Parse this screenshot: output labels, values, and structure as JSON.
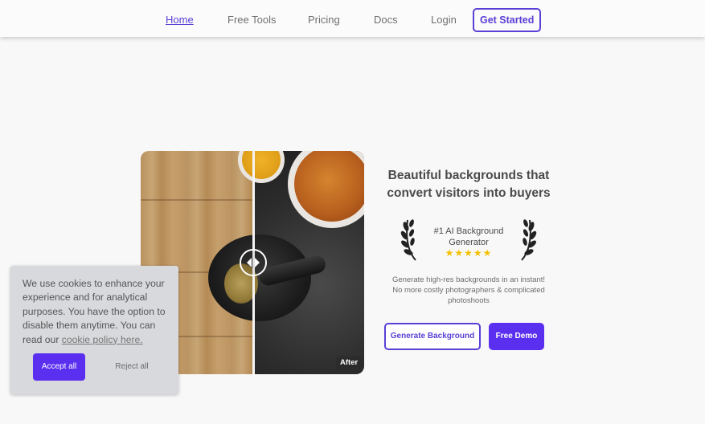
{
  "nav": {
    "items": [
      {
        "label": "Home",
        "active": true
      },
      {
        "label": "Free Tools"
      },
      {
        "label": "Pricing"
      },
      {
        "label": "Docs"
      },
      {
        "label": "Login"
      }
    ],
    "cta": "Get Started"
  },
  "compare": {
    "after_label": "After",
    "handle_icon": "compare-slider-icon"
  },
  "hero": {
    "headline_line1": "Beautiful backgrounds that",
    "headline_line2": "convert visitors into buyers",
    "award_line1": "#1 AI Background",
    "award_line2": "Generator",
    "stars": "★★★★★",
    "rating": 5,
    "sub_line1": "Generate high-res backgrounds in an instant!",
    "sub_line2": "No more costly photographers & complicated",
    "sub_line3": "photoshoots",
    "primary_button": "Generate Background",
    "secondary_button": "Free Demo"
  },
  "cookie": {
    "text": "We use cookies to enhance your experience and for analytical purposes. You have the option to disable them anytime. You can read our ",
    "link": "cookie policy here.",
    "accept": "Accept all",
    "reject": "Reject all"
  },
  "colors": {
    "accent": "#5b3fd6",
    "button": "#5b2ff0",
    "star": "#f6c000"
  }
}
